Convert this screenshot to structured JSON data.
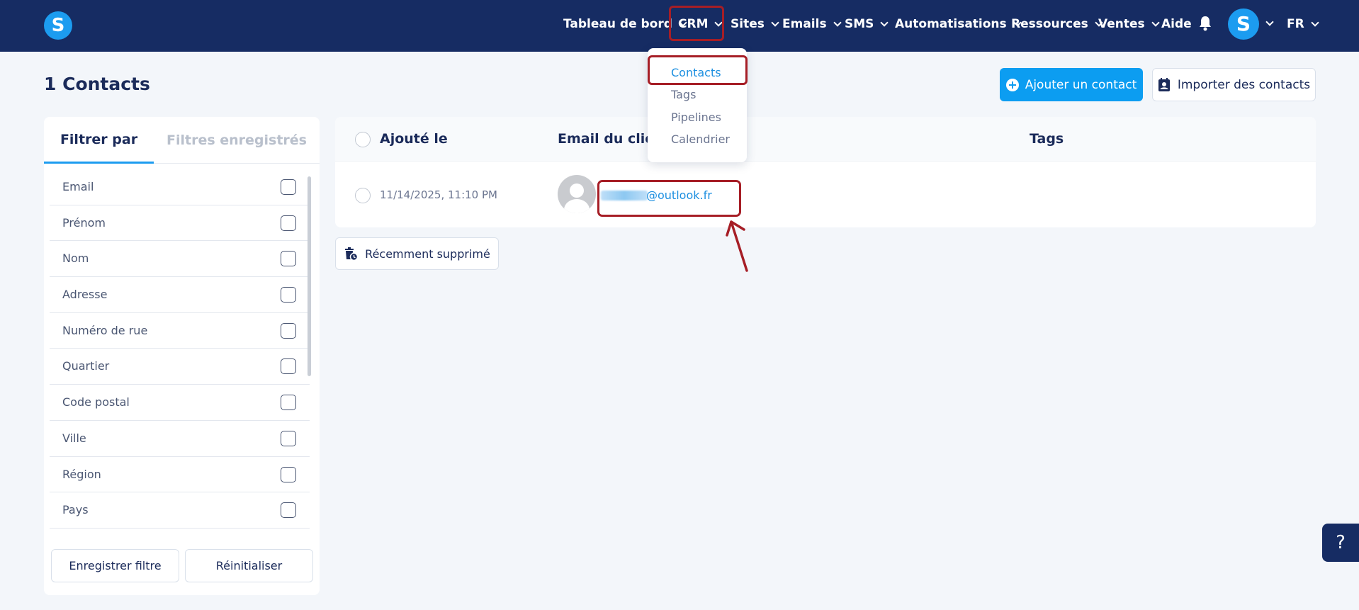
{
  "brand": {
    "logo_letter": "S",
    "accent": "#1c9cf0",
    "nav_bg": "#162c63",
    "highlight": "#a61e26"
  },
  "nav": {
    "items": [
      {
        "label": "Tableau de bord"
      },
      {
        "label": "CRM"
      },
      {
        "label": "Sites"
      },
      {
        "label": "Emails"
      },
      {
        "label": "SMS"
      },
      {
        "label": "Automatisations"
      },
      {
        "label": "Ressources"
      },
      {
        "label": "Ventes"
      }
    ],
    "help_label": "Aide",
    "bell_icon": "bell-icon",
    "user_avatar_letter": "S",
    "language": "FR"
  },
  "crm_menu": {
    "items": [
      {
        "label": "Contacts",
        "active": true
      },
      {
        "label": "Tags"
      },
      {
        "label": "Pipelines"
      },
      {
        "label": "Calendrier"
      }
    ]
  },
  "page": {
    "title": "1 Contacts",
    "add_button": "Ajouter un contact",
    "import_button": "Importer des contacts"
  },
  "filters": {
    "tab_active": "Filtrer par",
    "tab_saved": "Filtres enregistrés",
    "fields": [
      "Email",
      "Prénom",
      "Nom",
      "Adresse",
      "Numéro de rue",
      "Quartier",
      "Code postal",
      "Ville",
      "Région",
      "Pays"
    ],
    "save_button": "Enregistrer filtre",
    "reset_button": "Réinitialiser"
  },
  "table": {
    "columns": [
      "Ajouté le",
      "Email du client",
      "Tags"
    ],
    "rows": [
      {
        "added": "11/14/2025, 11:10 PM",
        "email_domain": "@outlook.fr"
      }
    ]
  },
  "deleted_button": "Récemment supprimé",
  "help_button": "?"
}
